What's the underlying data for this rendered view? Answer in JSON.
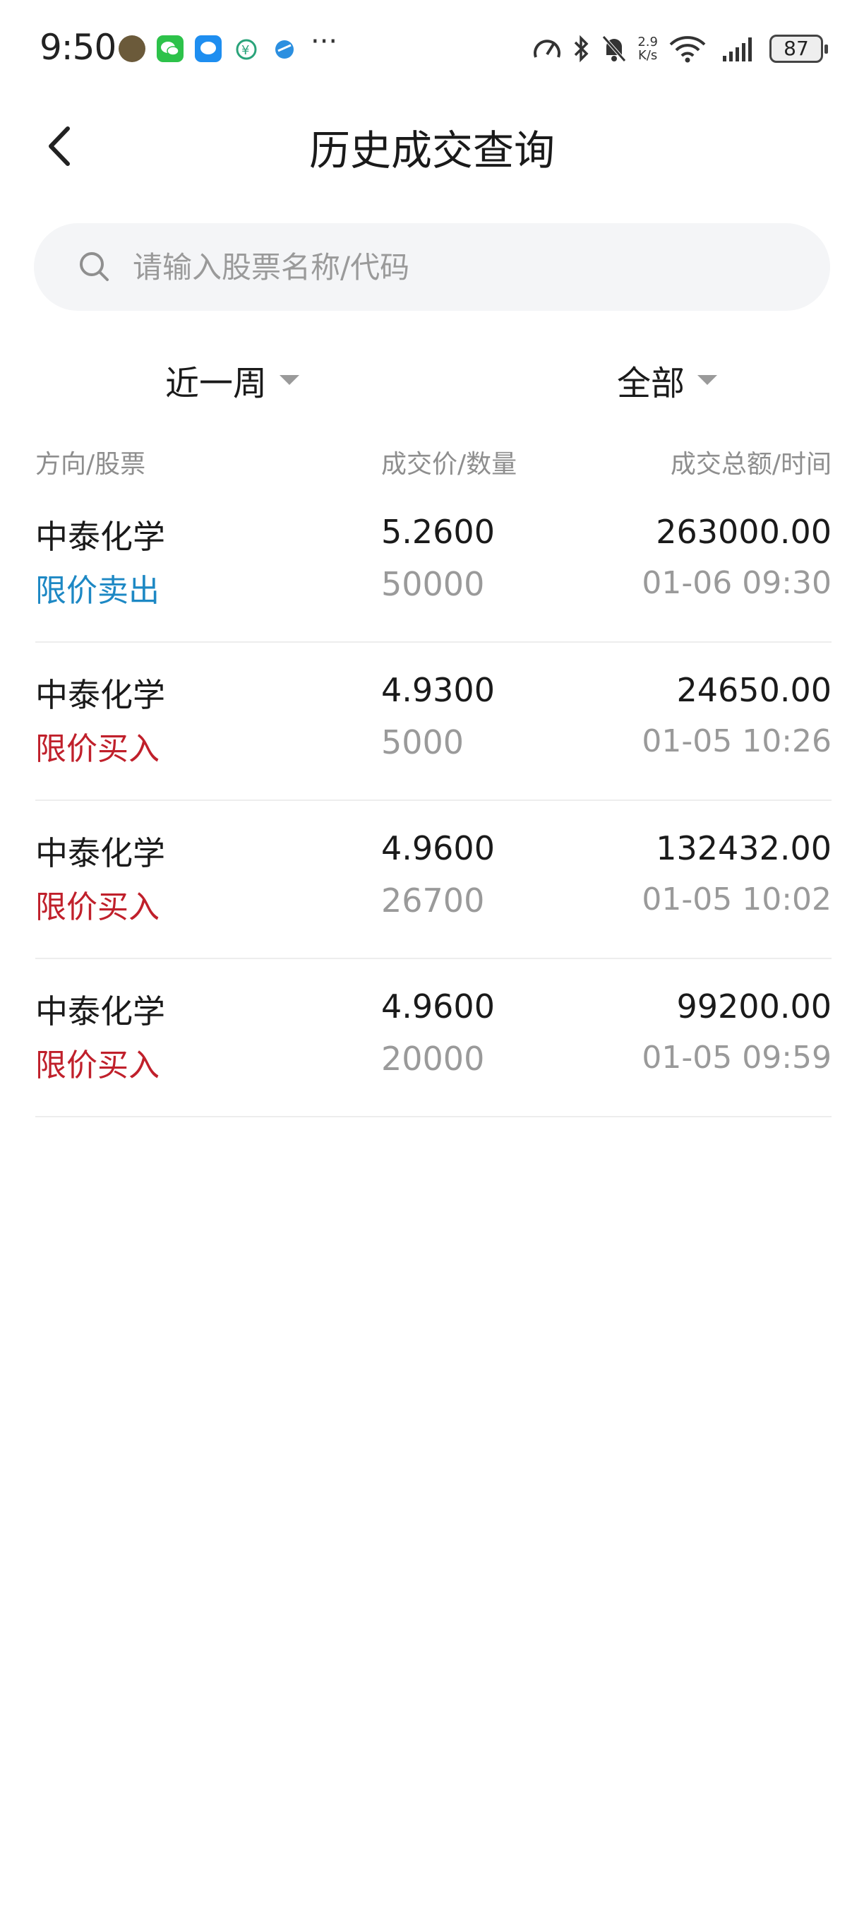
{
  "status_bar": {
    "time": "9:50",
    "more": "···",
    "net_speed_value": "2.9",
    "net_speed_unit": "K/s",
    "battery": "87",
    "app_icons": [
      "avatar-icon",
      "wechat-icon",
      "message-icon",
      "bank-icon",
      "browser-icon"
    ],
    "status_icons": [
      "speedometer-icon",
      "bluetooth-icon",
      "bell-muted-icon",
      "wifi-icon",
      "signal-icon"
    ]
  },
  "header": {
    "title": "历史成交查询",
    "back_icon": "chevron-left-icon"
  },
  "search": {
    "placeholder": "请输入股票名称/代码",
    "value": ""
  },
  "filters": {
    "period": "近一周",
    "type": "全部"
  },
  "columns": {
    "direction_stock": "方向/股票",
    "price_qty": "成交价/数量",
    "amount_time": "成交总额/时间"
  },
  "colors": {
    "sell": "#1d88c4",
    "buy": "#c0202b",
    "secondary_text": "#9a9a9a"
  },
  "trades": [
    {
      "name": "中泰化学",
      "direction": "限价卖出",
      "side": "sell",
      "price": "5.2600",
      "quantity": "50000",
      "amount": "263000.00",
      "time": "01-06 09:30"
    },
    {
      "name": "中泰化学",
      "direction": "限价买入",
      "side": "buy",
      "price": "4.9300",
      "quantity": "5000",
      "amount": "24650.00",
      "time": "01-05 10:26"
    },
    {
      "name": "中泰化学",
      "direction": "限价买入",
      "side": "buy",
      "price": "4.9600",
      "quantity": "26700",
      "amount": "132432.00",
      "time": "01-05 10:02"
    },
    {
      "name": "中泰化学",
      "direction": "限价买入",
      "side": "buy",
      "price": "4.9600",
      "quantity": "20000",
      "amount": "99200.00",
      "time": "01-05 09:59"
    }
  ]
}
